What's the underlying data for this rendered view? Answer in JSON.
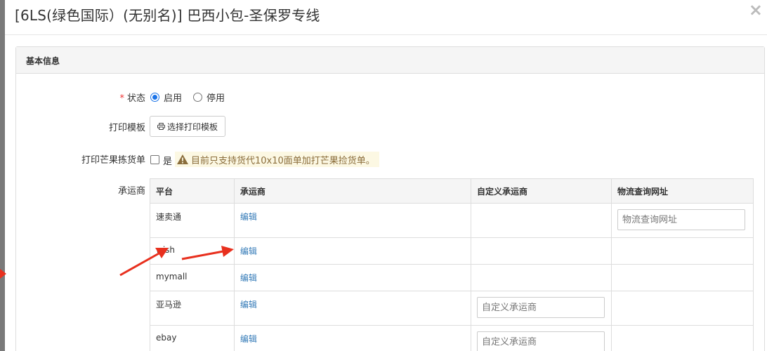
{
  "modal": {
    "title": "[6LS(绿色国际）(无别名)] 巴西小包-圣保罗专线",
    "close_glyph": "×"
  },
  "panel": {
    "heading": "基本信息"
  },
  "form": {
    "status": {
      "required_mark": "*",
      "label": "状态",
      "options": [
        {
          "label": "启用",
          "checked": true
        },
        {
          "label": "停用",
          "checked": false
        }
      ]
    },
    "print_template": {
      "label": "打印模板",
      "button_label": "选择打印模板"
    },
    "mango_pick": {
      "label": "打印芒果拣货单",
      "checkbox_label": "是",
      "checked": false,
      "warning": "目前只支持货代10x10面单加打芒果捡货单。"
    },
    "carrier": {
      "label": "承运商"
    }
  },
  "table": {
    "headers": [
      "平台",
      "承运商",
      "自定义承运商",
      "物流查询网址"
    ],
    "rows": [
      {
        "platform": "速卖通",
        "carrier_link": "编辑",
        "custom_placeholder": "",
        "tracking_placeholder": "物流查询网址"
      },
      {
        "platform": "wish",
        "carrier_link": "编辑",
        "custom_placeholder": "",
        "tracking_placeholder": ""
      },
      {
        "platform": "mymall",
        "carrier_link": "编辑",
        "custom_placeholder": "",
        "tracking_placeholder": ""
      },
      {
        "platform": "亚马逊",
        "carrier_link": "编辑",
        "custom_placeholder": "自定义承运商",
        "tracking_placeholder": ""
      },
      {
        "platform": "ebay",
        "carrier_link": "编辑",
        "custom_placeholder": "自定义承运商",
        "tracking_placeholder": ""
      }
    ]
  },
  "colors": {
    "link": "#337ab7",
    "annotation_arrow": "#e8301e",
    "warning_text": "#8a6d3b",
    "warning_bg": "#fcf8e3",
    "required": "#e33333"
  }
}
